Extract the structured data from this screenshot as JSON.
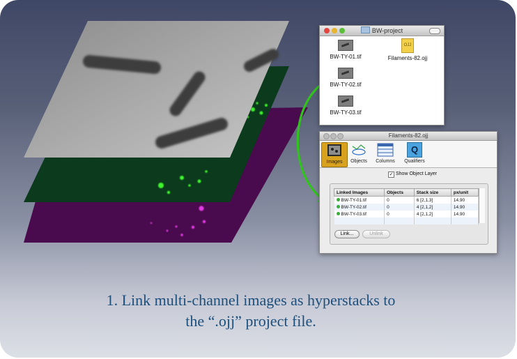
{
  "caption": {
    "line1": "1.  Link  multi-channel images as hyperstacks to",
    "line2": "the “.ojj” project file."
  },
  "finder_window": {
    "title": "BW-project",
    "files": [
      {
        "name": "BW-TY-01.tif",
        "icon": "image-file-icon"
      },
      {
        "name": "Filaments-82.ojj",
        "icon": "ojj-document-icon",
        "icon_text": "OJJ"
      },
      {
        "name": "BW-TY-02.tif",
        "icon": "image-file-icon"
      },
      {
        "name": "BW-TY-03.tif",
        "icon": "image-file-icon"
      }
    ]
  },
  "project_window": {
    "title": "Filaments-82.ojj",
    "tabs": [
      {
        "label": "Images",
        "icon": "images-icon",
        "selected": true
      },
      {
        "label": "Objects",
        "icon": "objects-icon",
        "selected": false
      },
      {
        "label": "Columns",
        "icon": "columns-icon",
        "selected": false
      },
      {
        "label": "Qualifiers",
        "icon": "qualifiers-icon",
        "icon_text": "Q",
        "selected": false
      }
    ],
    "show_object_layer": {
      "label": "Show Object Layer",
      "checked": true,
      "check_glyph": "✓"
    },
    "table": {
      "headers": [
        "Linked Images",
        "Objects",
        "Stack size",
        "px/unit"
      ],
      "rows": [
        [
          "BW-TY-01.tif",
          "0",
          "6 [2,1,3]",
          "14.90"
        ],
        [
          "BW-TY-02.tif",
          "0",
          "4 [2,1,2]",
          "14.90"
        ],
        [
          "BW-TY-03.tif",
          "0",
          "4 [2,1,2]",
          "14.90"
        ]
      ]
    },
    "buttons": {
      "link": "Link...",
      "unlink": "Unlink"
    }
  },
  "colors": {
    "caption": "#1d4f7c",
    "arrow": "#32c21e",
    "green_channel": "#0b3a1c",
    "magenta_channel": "#4a0b4e",
    "selected_tab": "#d8a21f"
  }
}
